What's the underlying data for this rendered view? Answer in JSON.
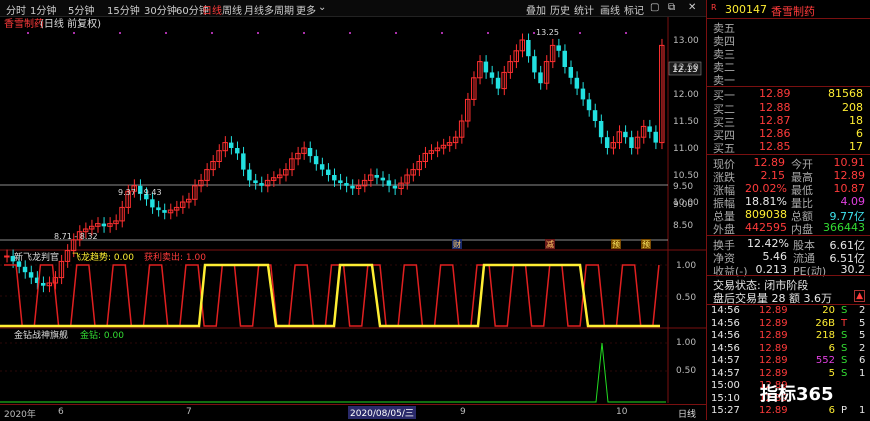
{
  "toolbar": {
    "items": [
      "分时",
      "1分钟",
      "5分钟",
      "15分钟",
      "30分钟",
      "60分钟",
      "日线",
      "周线",
      "月线",
      "多周期",
      "更多"
    ],
    "active": "日线",
    "right_items": [
      "叠加",
      "历史",
      "统计",
      "画线",
      "标记"
    ]
  },
  "main_chart": {
    "title": "香雪制药",
    "title_suffix": "(日线 前复权)",
    "price_label": "12.13",
    "high_label": "13.25",
    "mid_label": "9.37 - 9.43",
    "low_label": "8.71 - 8.32",
    "y_ticks": [
      "13.00",
      "12.50",
      "12.00",
      "11.50",
      "11.00",
      "10.50",
      "10.00",
      "9.50",
      "9.00",
      "8.50"
    ],
    "markers": [
      "财",
      "减",
      "预",
      "预"
    ]
  },
  "indicator1": {
    "name": "新飞龙判官",
    "label2": "飞龙趋势: 0.00",
    "label3": "获利卖出: 1.00",
    "y_ticks": [
      "1.00",
      "0.50"
    ]
  },
  "indicator2": {
    "name": "金钻战神旗舰",
    "label2": "金钻: 0.00",
    "y_ticks": [
      "1.00",
      "0.50"
    ]
  },
  "bottom_axis": {
    "labels": [
      "2020年",
      "6",
      "7",
      "2020/08/05/三",
      "9",
      "10"
    ],
    "period": "日线"
  },
  "right_panel": {
    "code": "300147",
    "name": "香雪制药",
    "sell_labels": [
      "卖五",
      "卖四",
      "卖三",
      "卖二",
      "卖一"
    ],
    "buy": [
      {
        "label": "买一",
        "price": "12.89",
        "vol": "81568"
      },
      {
        "label": "买二",
        "price": "12.88",
        "vol": "208"
      },
      {
        "label": "买三",
        "price": "12.87",
        "vol": "18"
      },
      {
        "label": "买四",
        "price": "12.86",
        "vol": "6"
      },
      {
        "label": "买五",
        "price": "12.85",
        "vol": "17"
      }
    ],
    "stats": [
      {
        "l1": "现价",
        "v1": "12.89",
        "l2": "今开",
        "v2": "10.91",
        "c1": "red",
        "c2": "red"
      },
      {
        "l1": "涨跌",
        "v1": "2.15",
        "l2": "最高",
        "v2": "12.89",
        "c1": "red",
        "c2": "red"
      },
      {
        "l1": "涨幅",
        "v1": "20.02%",
        "l2": "最低",
        "v2": "10.87",
        "c1": "red",
        "c2": "red"
      },
      {
        "l1": "振幅",
        "v1": "18.81%",
        "l2": "量比",
        "v2": "4.09",
        "c1": "white",
        "c2": "mag"
      },
      {
        "l1": "总量",
        "v1": "809038",
        "l2": "总额",
        "v2": "9.77亿",
        "c1": "yellow",
        "c2": "cyan"
      },
      {
        "l1": "外盘",
        "v1": "442595",
        "l2": "内盘",
        "v2": "366443",
        "c1": "red",
        "c2": "green"
      }
    ],
    "stats2": [
      {
        "l1": "换手",
        "v1": "12.42%",
        "l2": "股本",
        "v2": "6.61亿"
      },
      {
        "l1": "净资",
        "v1": "5.46",
        "l2": "流通",
        "v2": "6.51亿"
      },
      {
        "l1": "收益(-)",
        "v1": "0.213",
        "l2": "PE(动)",
        "v2": "30.2"
      }
    ],
    "status": "交易状态: 闭市阶段",
    "after": "盘后交易量 28 额 3.6万",
    "ticks": [
      {
        "t": "14:56",
        "p": "12.89",
        "v": "20",
        "s": "S",
        "n": "2"
      },
      {
        "t": "14:56",
        "p": "12.89",
        "v": "26B",
        "s": "T",
        "n": "5"
      },
      {
        "t": "14:56",
        "p": "12.89",
        "v": "218",
        "s": "S",
        "n": "5"
      },
      {
        "t": "14:56",
        "p": "12.89",
        "v": "6",
        "s": "S",
        "n": "2"
      },
      {
        "t": "14:57",
        "p": "12.89",
        "v": "552",
        "s": "S",
        "n": "6"
      },
      {
        "t": "14:57",
        "p": "12.89",
        "v": "5",
        "s": "S",
        "n": "1"
      },
      {
        "t": "15:00",
        "p": "12.89",
        "v": "",
        "s": "",
        "n": ""
      },
      {
        "t": "15:10",
        "p": "12.89",
        "v": "",
        "s": "",
        "n": ""
      },
      {
        "t": "15:27",
        "p": "12.89",
        "v": "6",
        "s": "P",
        "n": "1"
      }
    ]
  },
  "logo": "指标365"
}
